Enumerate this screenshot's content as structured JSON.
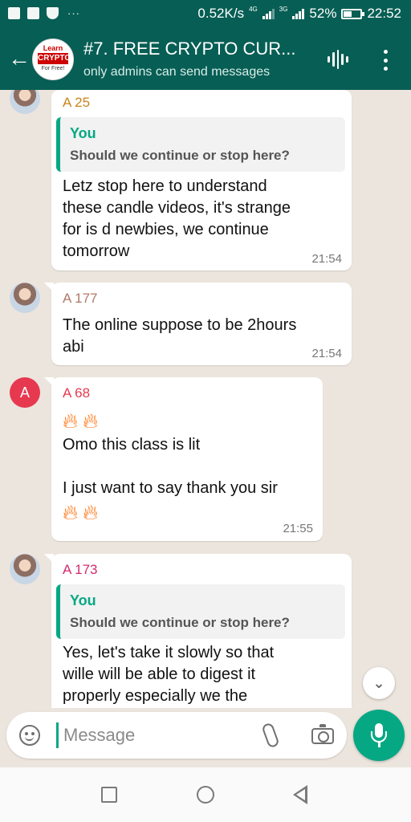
{
  "status_bar": {
    "net_speed": "0.52K/s",
    "network_1": "4G",
    "network_2": "3G",
    "battery_percent": "52%",
    "battery_level": 0.52,
    "time": "22:52"
  },
  "header": {
    "title": "#7. FREE CRYPTO CUR...",
    "subtitle": "only admins can send messages",
    "avatar_text": {
      "top": "Learn",
      "middle": "CRYPTO",
      "bottom": "For Free!"
    }
  },
  "messages": [
    {
      "sender": "A 25",
      "sender_color": "#c8861a",
      "quote": {
        "name": "You",
        "text": "Should we continue or stop here?"
      },
      "lines": [
        "Letz stop here to understand",
        "these candle videos,  it's strange",
        "for is d newbies, we continue",
        "tomorrow"
      ],
      "time": "21:54"
    },
    {
      "sender": "A 177",
      "sender_color": "#b07a6a",
      "lines": [
        "The online suppose to be 2hours",
        "abi"
      ],
      "time": "21:54"
    },
    {
      "sender": "A 68",
      "sender_color": "#e63950",
      "avatar_letter": "A",
      "lines": [
        "Omo this class is lit",
        "",
        "I just want to say thank you sir"
      ],
      "time": "21:55"
    },
    {
      "sender": "A 173",
      "sender_color": "#d12b6e",
      "quote": {
        "name": "You",
        "text": "Should we continue or stop here?"
      },
      "lines": [
        "Yes, let's take it slowly so that",
        "wille will be able to digest it",
        "properly especially we the"
      ]
    }
  ],
  "input": {
    "placeholder": "Message"
  },
  "colors": {
    "header": "#075e54",
    "accent": "#06a884",
    "chat_bg": "#ece5dd"
  }
}
